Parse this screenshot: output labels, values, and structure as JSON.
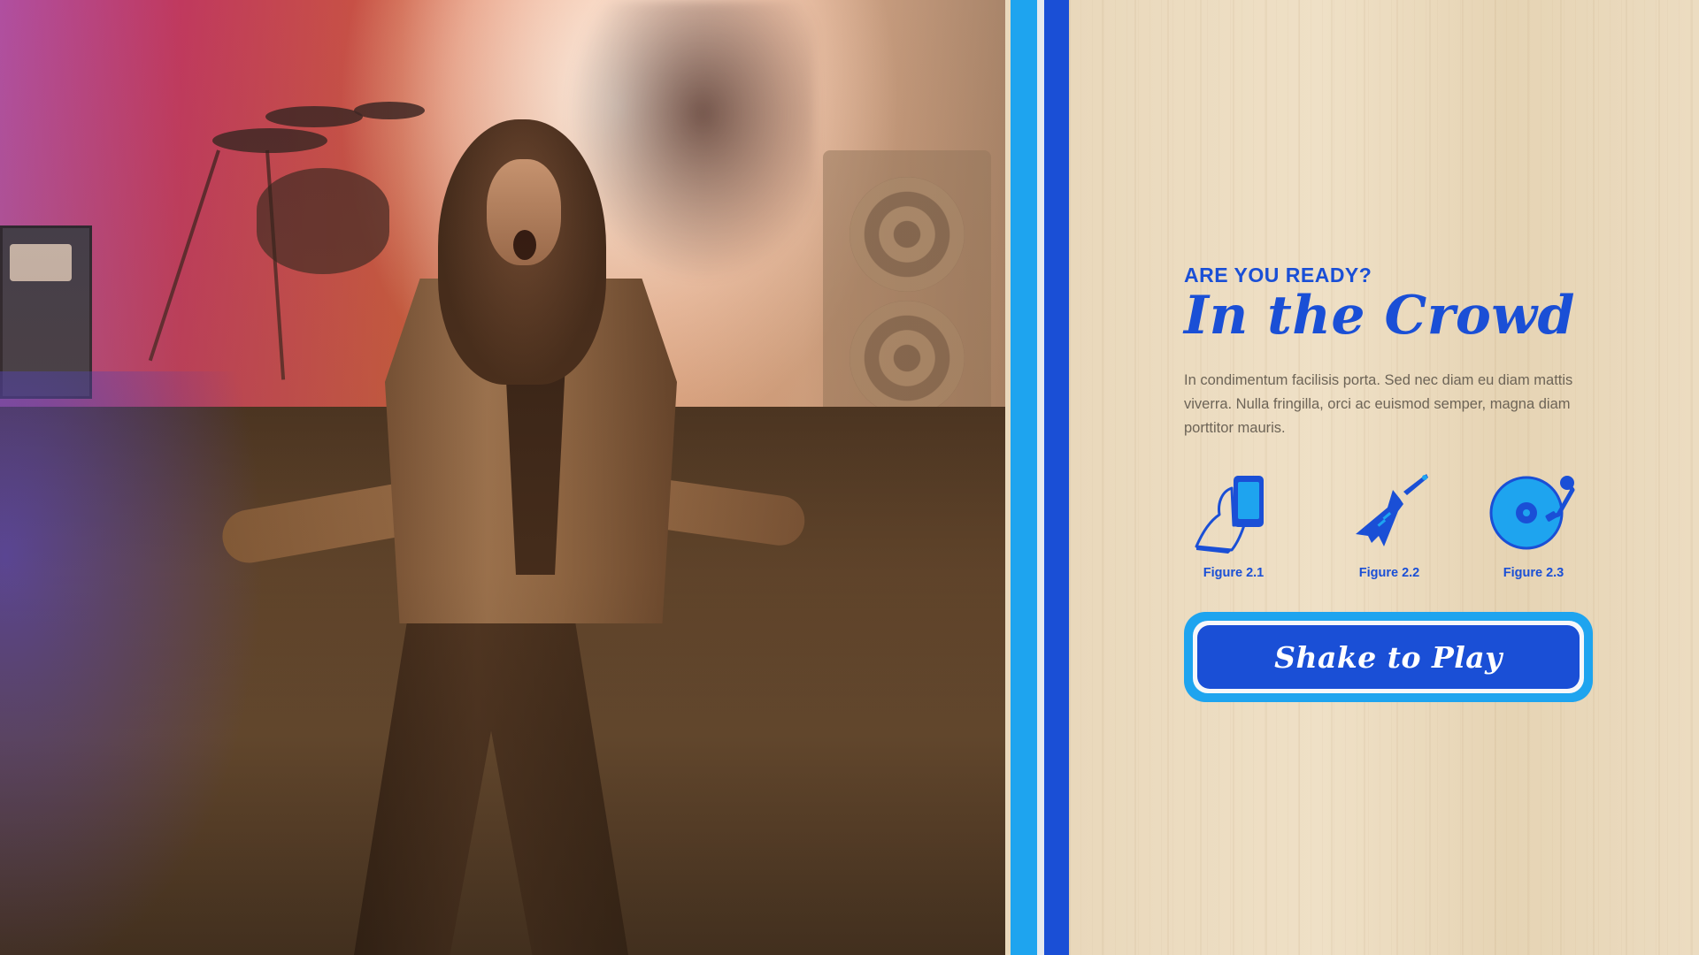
{
  "intro": {
    "eyebrow": "ARE YOU READY?",
    "title": "In the Crowd",
    "body": "In condimentum facilisis porta. Sed nec diam eu diam mattis viverra. Nulla fringilla, orci ac euismod semper, magna diam porttitor mauris."
  },
  "figures": [
    {
      "icon": "hand-phone-icon",
      "caption": "Figure 2.1"
    },
    {
      "icon": "electric-guitar-icon",
      "caption": "Figure 2.2"
    },
    {
      "icon": "turntable-icon",
      "caption": "Figure 2.3"
    }
  ],
  "cta": {
    "label": "Shake to Play"
  },
  "colors": {
    "primary_blue": "#1a4fd6",
    "light_blue": "#1ea4ef",
    "body_text": "#6d6457",
    "wood": "#e9d8bb"
  }
}
